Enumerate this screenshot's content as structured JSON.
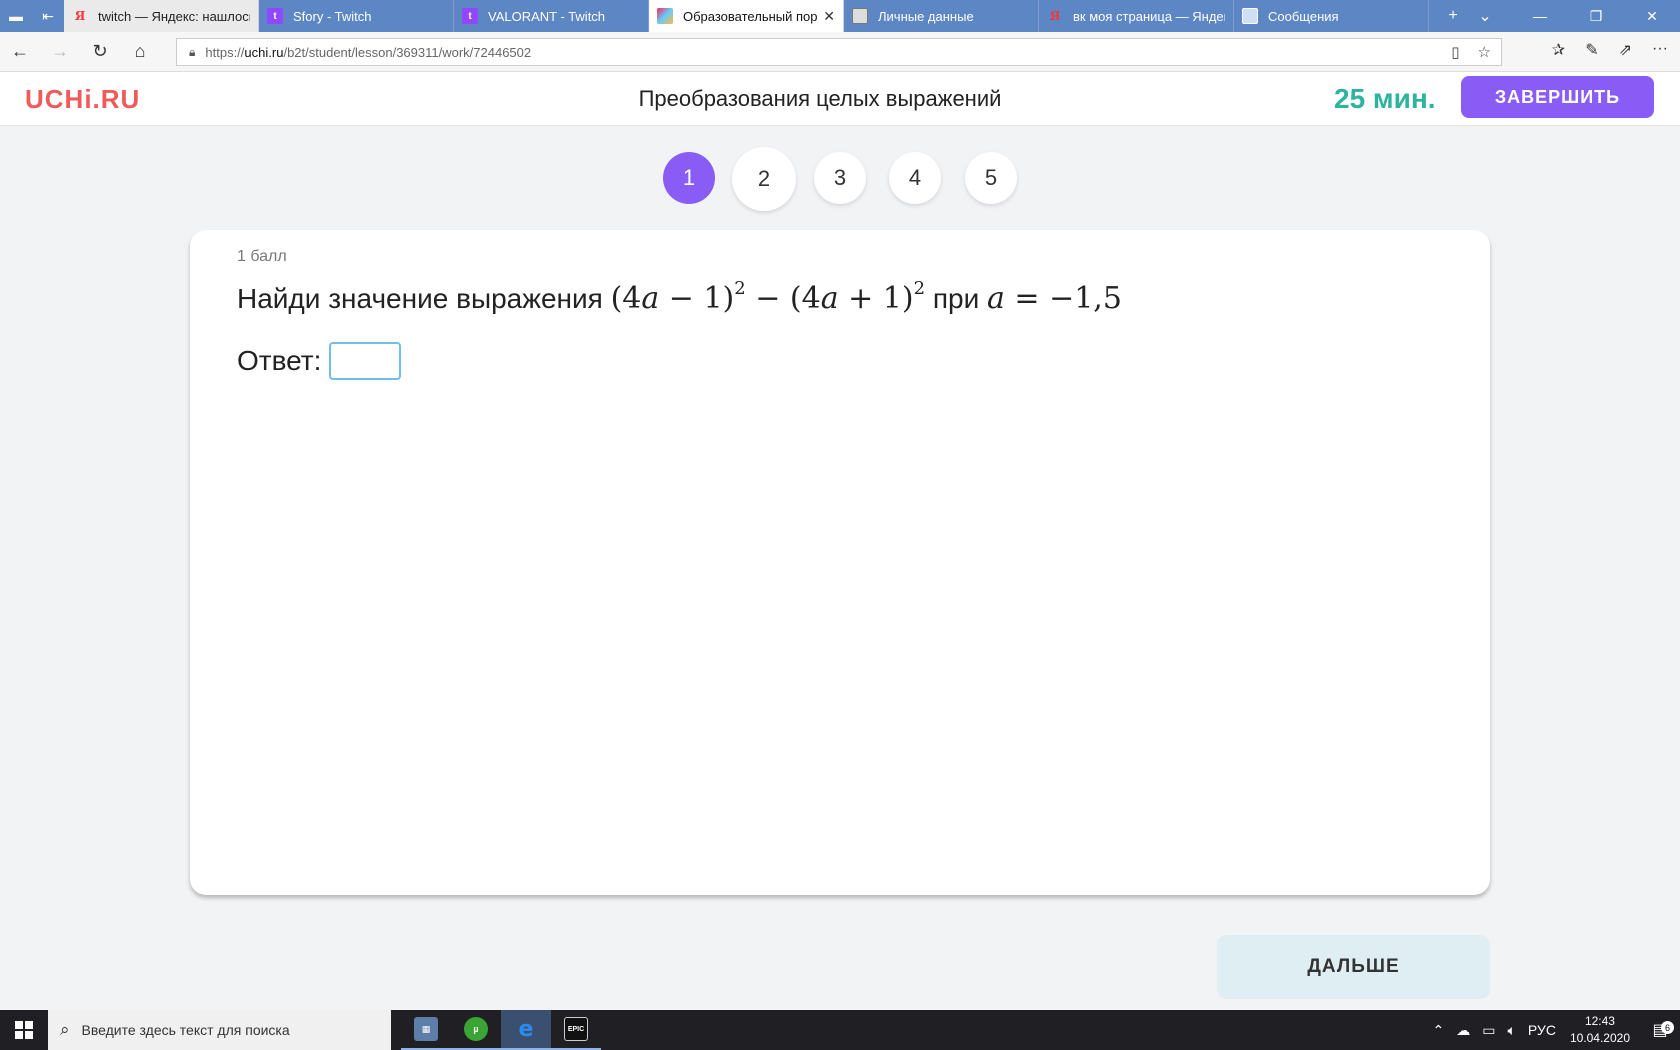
{
  "browser": {
    "tabs": [
      {
        "title": "twitch — Яндекс: нашлось",
        "favicon": "yandex-icon",
        "fav_glyph": "Я"
      },
      {
        "title": "Sfory - Twitch",
        "favicon": "twitch-icon",
        "fav_glyph": "t"
      },
      {
        "title": "VALORANT - Twitch",
        "favicon": "twitch-icon",
        "fav_glyph": "t"
      },
      {
        "title": "Образовательный пор",
        "favicon": "uchi-icon",
        "fav_glyph": ""
      },
      {
        "title": "Личные данные",
        "favicon": "document-icon",
        "fav_glyph": ""
      },
      {
        "title": "вк моя страница — Яндек",
        "favicon": "yandex-icon",
        "fav_glyph": "Я"
      },
      {
        "title": "Сообщения",
        "favicon": "vk-messages-icon",
        "fav_glyph": ""
      }
    ],
    "new_tab_glyph": "+",
    "tab_list_glyph": "⌄",
    "address": {
      "prefix": "https://",
      "host": "uchi.ru",
      "path": "/b2t/student/lesson/369311/work/72446502"
    }
  },
  "site": {
    "logo": "UCHi.RU",
    "lesson_title": "Преобразования целых выражений",
    "timer": "25 мин.",
    "finish_label": "ЗАВЕРШИТЬ",
    "accent_color": "#8a5cf6",
    "timer_color": "#2db39e",
    "logo_color": "#f05a5a"
  },
  "pager": {
    "pages": [
      "1",
      "2",
      "3",
      "4",
      "5"
    ],
    "active": "1"
  },
  "task": {
    "points": "1 балл",
    "question_prefix": "Найди значение выражения",
    "question_joiner": "при",
    "answer_label": "Ответ:",
    "answer_value": ""
  },
  "next_label": "ДАЛЬШЕ",
  "taskbar": {
    "search_placeholder": "Введите здесь текст для поиска",
    "apps": [
      {
        "name": "calendar-app-icon",
        "glyph": "▦"
      },
      {
        "name": "utorrent-icon",
        "glyph": "µ"
      },
      {
        "name": "edge-icon",
        "glyph": "e"
      },
      {
        "name": "epic-games-icon",
        "glyph": "EPIC"
      }
    ],
    "language": "РУС",
    "time": "12:43",
    "date": "10.04.2020",
    "notifications_count": "6"
  }
}
